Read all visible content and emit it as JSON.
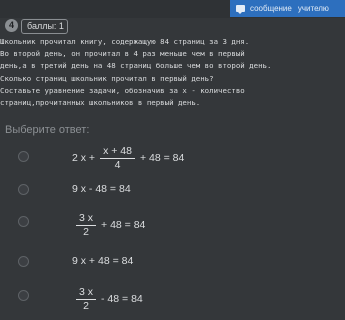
{
  "header": {
    "message_label": "сообщение",
    "teacher_label": "учителю"
  },
  "task": {
    "number": "4",
    "points_label": "баллы: 1"
  },
  "question_lines": [
    "Школьник прочитал книгу, содержащую 84 страниц за 3 дня.",
    "Во второй день, он прочитал в 4 раз меньше чем в первый",
    "день,а в третий день на 48 страниц больше чем во второй день.",
    "Сколько страниц школьник прочитал в первый день?",
    "Составьте уравнение задачи, обозначив за х - количество",
    "страниц,прочитанных школьников в первый день."
  ],
  "choose_label": "Выберите ответ:",
  "options": {
    "opt1": {
      "lead": "2 х +",
      "num": "х + 48",
      "den": "4",
      "tail": "+ 48 = 84"
    },
    "opt2": {
      "text": "9 х - 48 = 84"
    },
    "opt3": {
      "num": "3 х",
      "den": "2",
      "tail": "+ 48 = 84"
    },
    "opt4": {
      "text": "9 х + 48 = 84"
    },
    "opt5": {
      "num": "3 х",
      "den": "2",
      "tail": "- 48 = 84"
    }
  }
}
